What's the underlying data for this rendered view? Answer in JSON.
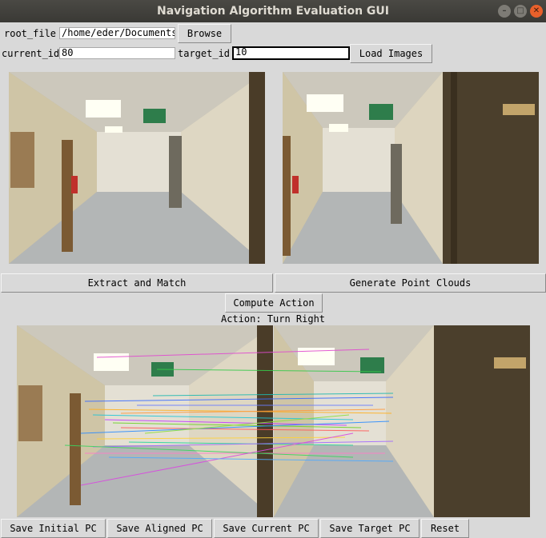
{
  "window": {
    "title": "Navigation Algorithm Evaluation GUI"
  },
  "row1": {
    "root_label": "root_file",
    "root_value": "/home/eder/Documents",
    "browse_label": "Browse"
  },
  "row2": {
    "current_label": "current_id",
    "current_value": "80",
    "target_label": "target_id",
    "target_value": "10",
    "load_label": "Load Images"
  },
  "images": {
    "current": "hallway-current-image",
    "target": "hallway-target-image",
    "matches": "feature-matches-image"
  },
  "actions": {
    "extract_label": "Extract and Match",
    "generate_label": "Generate Point Clouds",
    "compute_label": "Compute Action",
    "action_text": "Action: Turn Right"
  },
  "bottom": {
    "save_initial": "Save Initial PC",
    "save_aligned": "Save Aligned PC",
    "save_current": "Save Current PC",
    "save_target": "Save Target PC",
    "reset": "Reset"
  },
  "colors": {
    "titlebar": "#3c3b37",
    "window_bg": "#d9d9d9",
    "close_button": "#e8602b"
  }
}
